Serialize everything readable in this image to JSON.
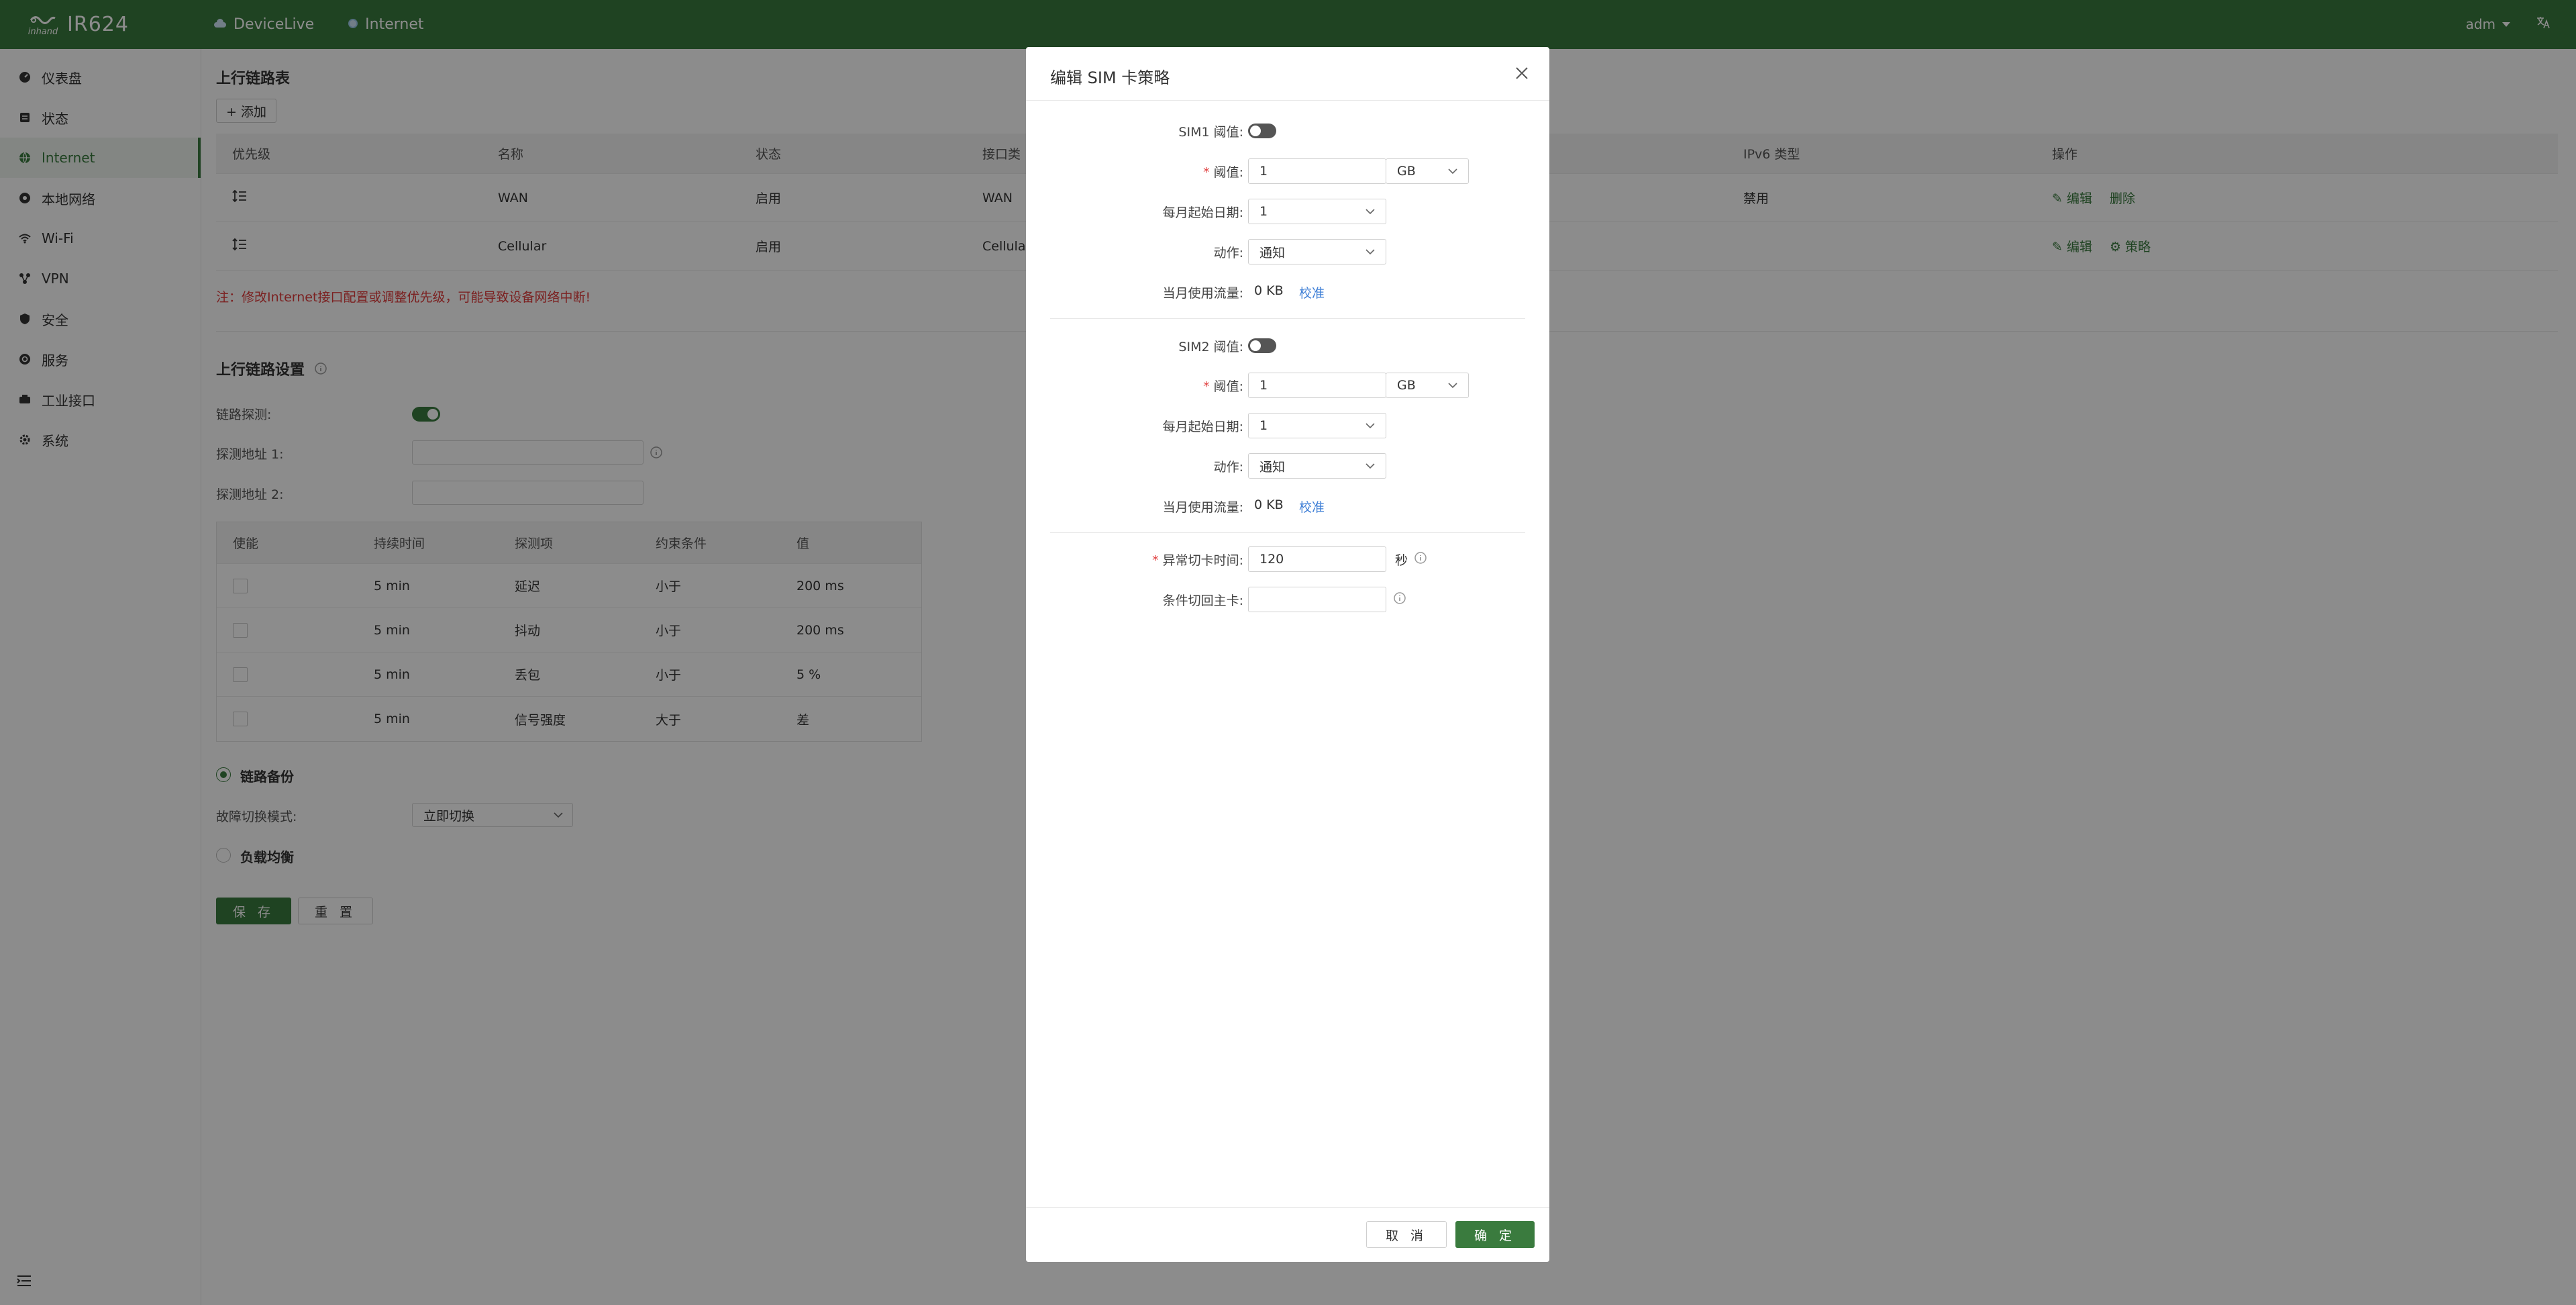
{
  "topbar": {
    "logo_text": "inhand",
    "model": "IR624",
    "nav": [
      {
        "label": "DeviceLive"
      },
      {
        "label": "Internet"
      }
    ],
    "user": "adm",
    "lang_icon": "translate-icon"
  },
  "sidebar": {
    "items": [
      {
        "label": "仪表盘",
        "icon": "dashboard-icon"
      },
      {
        "label": "状态",
        "icon": "status-icon"
      },
      {
        "label": "Internet",
        "icon": "globe-icon",
        "active": true
      },
      {
        "label": "本地网络",
        "icon": "network-icon"
      },
      {
        "label": "Wi-Fi",
        "icon": "wifi-icon"
      },
      {
        "label": "VPN",
        "icon": "vpn-icon"
      },
      {
        "label": "安全",
        "icon": "shield-icon"
      },
      {
        "label": "服务",
        "icon": "service-icon"
      },
      {
        "label": "工业接口",
        "icon": "industrial-icon"
      },
      {
        "label": "系统",
        "icon": "gear-icon"
      }
    ]
  },
  "uplink": {
    "title": "上行链路表",
    "add_label": "+ 添加",
    "columns": [
      "优先级",
      "名称",
      "状态",
      "接口类",
      "IPv6 类型",
      "操作"
    ],
    "rows": [
      {
        "name": "WAN",
        "status": "启用",
        "iface": "WAN",
        "ipv6": "禁用",
        "actions": [
          "编辑",
          "删除"
        ]
      },
      {
        "name": "Cellular",
        "status": "启用",
        "iface": "Cellula",
        "ipv6": "",
        "actions": [
          "编辑",
          "策略"
        ]
      }
    ],
    "warning": "注：修改Internet接口配置或调整优先级，可能导致设备网络中断!"
  },
  "settings": {
    "title": "上行链路设置",
    "probe_label": "链路探测:",
    "addr1_label": "探测地址 1:",
    "addr2_label": "探测地址 2:",
    "table_columns": [
      "使能",
      "持续时间",
      "探测项",
      "约束条件",
      "值"
    ],
    "table_rows": [
      {
        "duration": "5 min",
        "item": "延迟",
        "cond": "小于",
        "value": "200 ms"
      },
      {
        "duration": "5 min",
        "item": "抖动",
        "cond": "小于",
        "value": "200 ms"
      },
      {
        "duration": "5 min",
        "item": "丢包",
        "cond": "小于",
        "value": "5 %"
      },
      {
        "duration": "5 min",
        "item": "信号强度",
        "cond": "大于",
        "value": "差"
      }
    ],
    "backup_label": "链路备份",
    "failover_label": "故障切换模式:",
    "failover_value": "立即切换",
    "balance_label": "负载均衡",
    "save_label": "保 存",
    "reset_label": "重 置"
  },
  "modal": {
    "title": "编辑 SIM 卡策略",
    "sim1": {
      "threshold_toggle_label": "SIM1 阈值:",
      "threshold_label": "阈值:",
      "threshold_value": "1",
      "unit": "GB",
      "start_day_label": "每月起始日期:",
      "start_day_value": "1",
      "action_label": "动作:",
      "action_value": "通知",
      "usage_label": "当月使用流量:",
      "usage_value": "0  KB",
      "calibrate": "校准"
    },
    "sim2": {
      "threshold_toggle_label": "SIM2 阈值:",
      "threshold_label": "阈值:",
      "threshold_value": "1",
      "unit": "GB",
      "start_day_label": "每月起始日期:",
      "start_day_value": "1",
      "action_label": "动作:",
      "action_value": "通知",
      "usage_label": "当月使用流量:",
      "usage_value": "0  KB",
      "calibrate": "校准"
    },
    "switch_time_label": "异常切卡时间:",
    "switch_time_value": "120",
    "switch_time_unit": "秒",
    "return_label": "条件切回主卡:",
    "return_value": "",
    "cancel_label": "取 消",
    "ok_label": "确 定"
  }
}
